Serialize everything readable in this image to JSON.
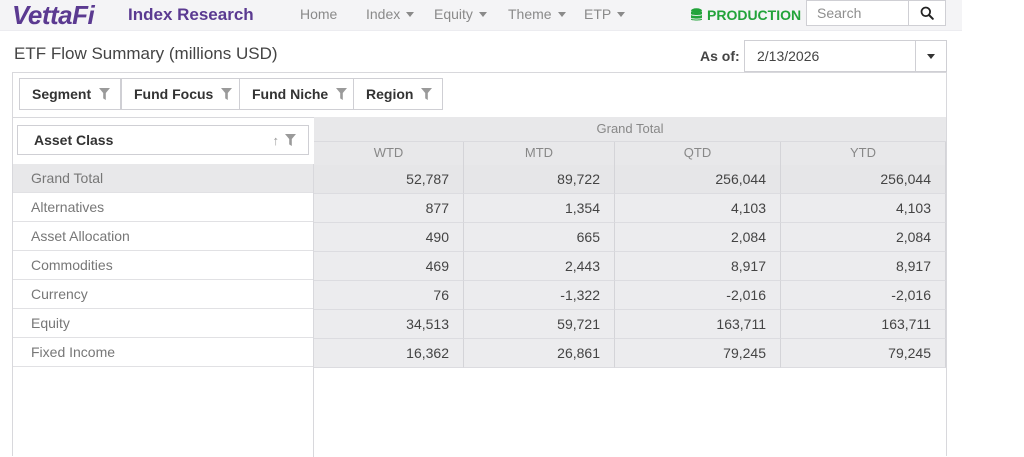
{
  "nav": {
    "logo": "VettaFi",
    "brand_sub": "Index Research",
    "items": [
      {
        "label": "Home",
        "dropdown": false
      },
      {
        "label": "Index",
        "dropdown": true
      },
      {
        "label": "Equity",
        "dropdown": true
      },
      {
        "label": "Theme",
        "dropdown": true
      },
      {
        "label": "ETP",
        "dropdown": true
      }
    ],
    "environment": "PRODUCTION",
    "search_placeholder": "Search"
  },
  "page": {
    "title": "ETF Flow Summary (millions USD)",
    "as_of_label": "As of:",
    "as_of_value": "2/13/2026"
  },
  "filters": [
    "Segment",
    "Fund Focus",
    "Fund Niche",
    "Region"
  ],
  "pivot": {
    "row_header": "Asset Class",
    "grand_header": "Grand Total",
    "columns": [
      "WTD",
      "MTD",
      "QTD",
      "YTD"
    ],
    "rows": [
      {
        "label": "Grand Total",
        "values": [
          "52,787",
          "89,722",
          "256,044",
          "256,044"
        ],
        "total": true
      },
      {
        "label": "Alternatives",
        "values": [
          "877",
          "1,354",
          "4,103",
          "4,103"
        ]
      },
      {
        "label": "Asset Allocation",
        "values": [
          "490",
          "665",
          "2,084",
          "2,084"
        ]
      },
      {
        "label": "Commodities",
        "values": [
          "469",
          "2,443",
          "8,917",
          "8,917"
        ]
      },
      {
        "label": "Currency",
        "values": [
          "76",
          "-1,322",
          "-2,016",
          "-2,016"
        ]
      },
      {
        "label": "Equity",
        "values": [
          "34,513",
          "59,721",
          "163,711",
          "163,711"
        ]
      },
      {
        "label": "Fixed Income",
        "values": [
          "16,362",
          "26,861",
          "79,245",
          "79,245"
        ]
      }
    ]
  },
  "colors": {
    "brand": "#5b3a91",
    "production": "#22a33a",
    "grid_fill": "#ececee"
  }
}
